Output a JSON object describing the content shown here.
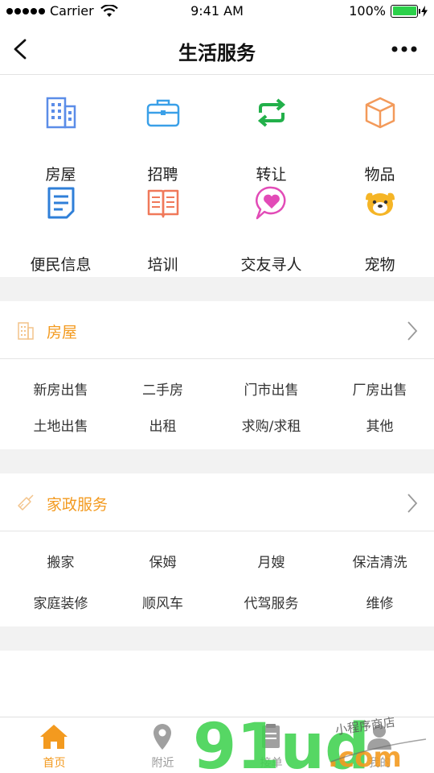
{
  "status": {
    "carrier": "Carrier",
    "time": "9:41 AM",
    "battery": "100%"
  },
  "nav": {
    "title": "生活服务"
  },
  "categories": [
    {
      "label": "房屋",
      "icon": "building-icon",
      "color": "#5b8de8"
    },
    {
      "label": "招聘",
      "icon": "briefcase-icon",
      "color": "#3aa0e8"
    },
    {
      "label": "转让",
      "icon": "swap-arrows-icon",
      "color": "#22b04a"
    },
    {
      "label": "物品",
      "icon": "box-icon",
      "color": "#f39a5a"
    },
    {
      "label": "便民信息",
      "icon": "document-icon",
      "color": "#2f7fd8"
    },
    {
      "label": "培训",
      "icon": "open-book-icon",
      "color": "#f0795a"
    },
    {
      "label": "交友寻人",
      "icon": "heart-bubble-icon",
      "color": "#e24bb7"
    },
    {
      "label": "宠物",
      "icon": "dog-icon",
      "color": "#f5b526"
    }
  ],
  "housing": {
    "title": "房屋",
    "items": [
      "新房出售",
      "二手房",
      "门市出售",
      "厂房出售",
      "土地出售",
      "出租",
      "求购/求租",
      "其他"
    ]
  },
  "homeservice": {
    "title": "家政服务",
    "items": [
      "搬家",
      "保姆",
      "月嫂",
      "保洁清洗",
      "家庭装修",
      "顺风车",
      "代驾服务",
      "维修"
    ]
  },
  "tabs": [
    {
      "label": "首页",
      "active": true
    },
    {
      "label": "附近",
      "active": false
    },
    {
      "label": "接单",
      "active": false
    },
    {
      "label": "我的",
      "active": false
    }
  ],
  "watermark": {
    "text": "91ud",
    "domain": ".com",
    "handwritten": "小程序商店"
  },
  "colors": {
    "accent": "#f39a1f",
    "divider": "#f2f2f2",
    "battery": "#2bd14a"
  }
}
